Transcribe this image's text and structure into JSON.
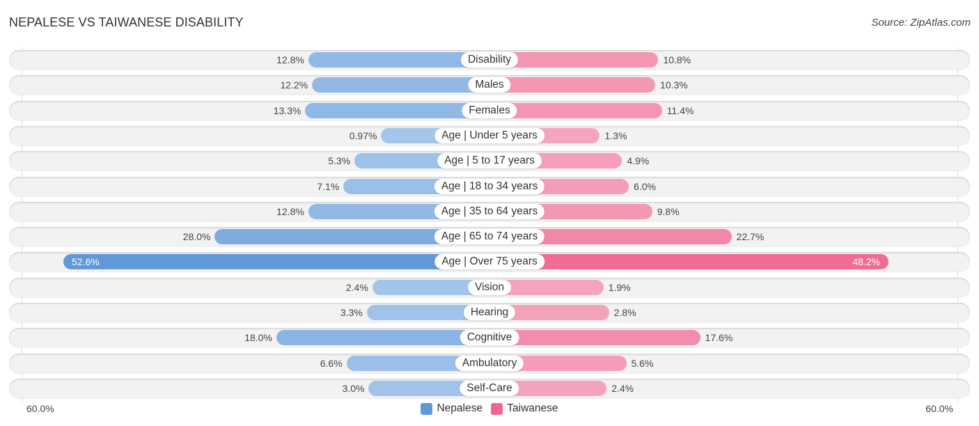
{
  "header": {
    "title": "NEPALESE VS TAIWANESE DISABILITY",
    "source": "Source: ZipAtlas.com"
  },
  "legend": {
    "nepalese_label": "Nepalese",
    "taiwanese_label": "Taiwanese"
  },
  "axis": {
    "left_label": "60.0%",
    "right_label": "60.0%"
  },
  "colors": {
    "nepalese_light": "#a8c8ec",
    "nepalese_dark": "#6199d8",
    "taiwanese_light": "#f6a8c0",
    "taiwanese_dark": "#f06890"
  },
  "chart_data": {
    "type": "bar",
    "orientation": "horizontal-diverging",
    "title": "NEPALESE VS TAIWANESE DISABILITY",
    "xlabel": "",
    "ylabel": "",
    "xlim": [
      -60,
      60
    ],
    "unit": "%",
    "legend_position": "bottom-center",
    "categories": [
      "Disability",
      "Males",
      "Females",
      "Age | Under 5 years",
      "Age | 5 to 17 years",
      "Age | 18 to 34 years",
      "Age | 35 to 64 years",
      "Age | 65 to 74 years",
      "Age | Over 75 years",
      "Vision",
      "Hearing",
      "Cognitive",
      "Ambulatory",
      "Self-Care"
    ],
    "series": [
      {
        "name": "Nepalese",
        "values": [
          12.8,
          12.2,
          13.3,
          0.97,
          5.3,
          7.1,
          12.8,
          28.0,
          52.6,
          2.4,
          3.3,
          18.0,
          6.6,
          3.0
        ],
        "labels": [
          "12.8%",
          "12.2%",
          "13.3%",
          "0.97%",
          "5.3%",
          "7.1%",
          "12.8%",
          "28.0%",
          "52.6%",
          "2.4%",
          "3.3%",
          "18.0%",
          "6.6%",
          "3.0%"
        ]
      },
      {
        "name": "Taiwanese",
        "values": [
          10.8,
          10.3,
          11.4,
          1.3,
          4.9,
          6.0,
          9.8,
          22.7,
          48.2,
          1.9,
          2.8,
          17.6,
          5.6,
          2.4
        ],
        "labels": [
          "10.8%",
          "10.3%",
          "11.4%",
          "1.3%",
          "4.9%",
          "6.0%",
          "9.8%",
          "22.7%",
          "48.2%",
          "1.9%",
          "2.8%",
          "17.6%",
          "5.6%",
          "2.4%"
        ]
      }
    ]
  }
}
